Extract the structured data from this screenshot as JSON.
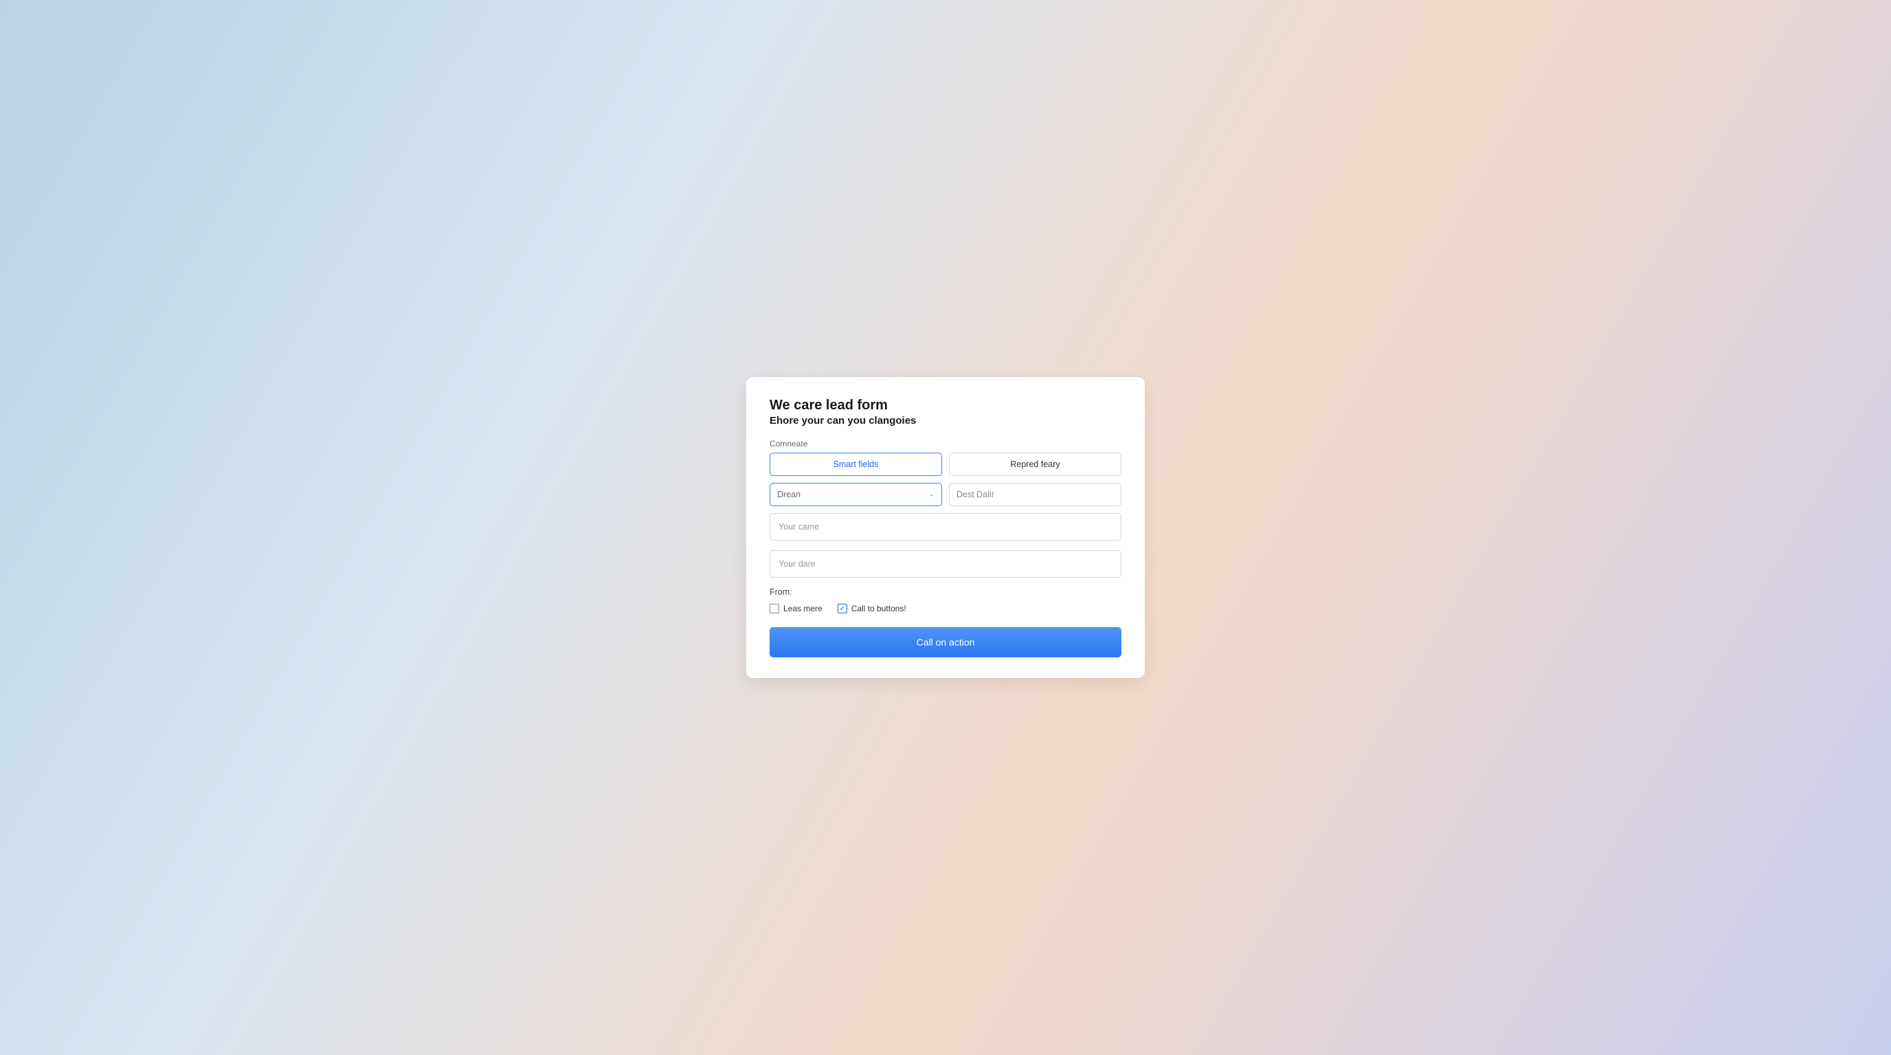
{
  "card": {
    "title": "We care lead form",
    "subtitle": "Ehore your can you clangoies",
    "section_label": "Comneate",
    "row1": {
      "smart_fields": "Smart fields",
      "repred_feary": "Repred feary"
    },
    "row2": {
      "drean": "Drean",
      "dest_dalir": "Dest Dalir"
    },
    "input1_placeholder": "Your came",
    "input2_placeholder": "Your dare",
    "from_label": "From:",
    "checks": {
      "less_mere": "Leas mere",
      "call_to_buttons": "Call to buttons!"
    },
    "cta_label": "Call on action"
  }
}
